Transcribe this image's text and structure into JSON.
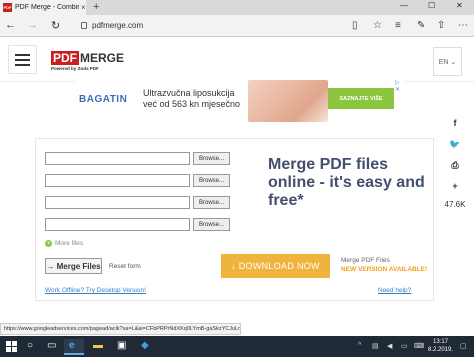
{
  "browser": {
    "tab_title": "PDF Merge - Combine/I",
    "tab_favicon": "PDF",
    "tab_close": "×",
    "new_tab": "+",
    "url": "pdfmerge.com",
    "window_controls": [
      "—",
      "☐",
      "✕"
    ]
  },
  "site": {
    "logo_pdf": "PDF",
    "logo_merge": "MERGE",
    "logo_sub": "Powered by Soda PDF",
    "language": "EN ⌄"
  },
  "ad": {
    "brand": "BAGATIN",
    "line1": "Ultrazvučna liposukcija",
    "line2": "već od 563 kn mjesečno",
    "cta": "SAZNAJTE VIŠE",
    "close": "▷ ✕"
  },
  "social": {
    "share_count": "47.6K"
  },
  "uploader": {
    "rows": [
      {
        "browse_label": "Browse..."
      },
      {
        "browse_label": "Browse..."
      },
      {
        "browse_label": "Browse..."
      },
      {
        "browse_label": "Browse..."
      }
    ],
    "more_files": "More files",
    "merge_button": "→ Merge Files",
    "reset_link": "Reset form"
  },
  "promo": {
    "headline": "Merge PDF files online - it's easy and free*",
    "download_button": "↓ DOWNLOAD NOW",
    "version_name": "Merge PDF Files",
    "version_badge": "NEW VERSION AVAILABLE!",
    "offline_link": "Work Offline? Try Desktop Version!",
    "help_link": "Need help?"
  },
  "statusbar": {
    "url": "https://www.googleadservices.com/pagead/aclk?sa=L&ai=CFbPRPrNdXKq0LYmB-gaSkzYCJuLm"
  },
  "taskbar": {
    "time": "13:17",
    "date": "8.2.2019."
  }
}
